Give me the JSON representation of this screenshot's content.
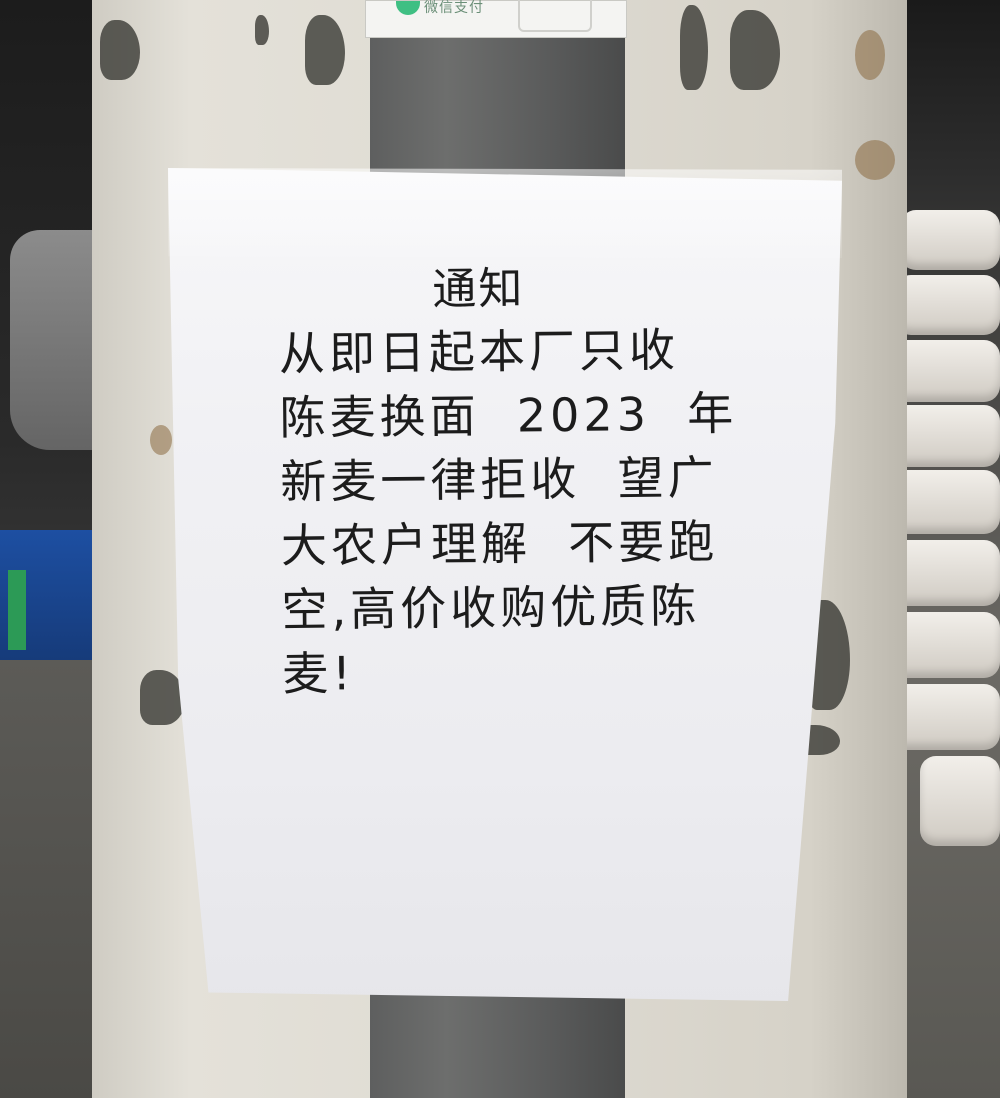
{
  "sticker": {
    "text": "微信支付"
  },
  "notice": {
    "title": "通知",
    "lines": [
      "从即日起本厂只收",
      "陈麦换面  2023  年",
      "新麦一律拒收  望广",
      "大农户理解  不要跑",
      "空,高价收购优质陈",
      "麦!"
    ]
  }
}
